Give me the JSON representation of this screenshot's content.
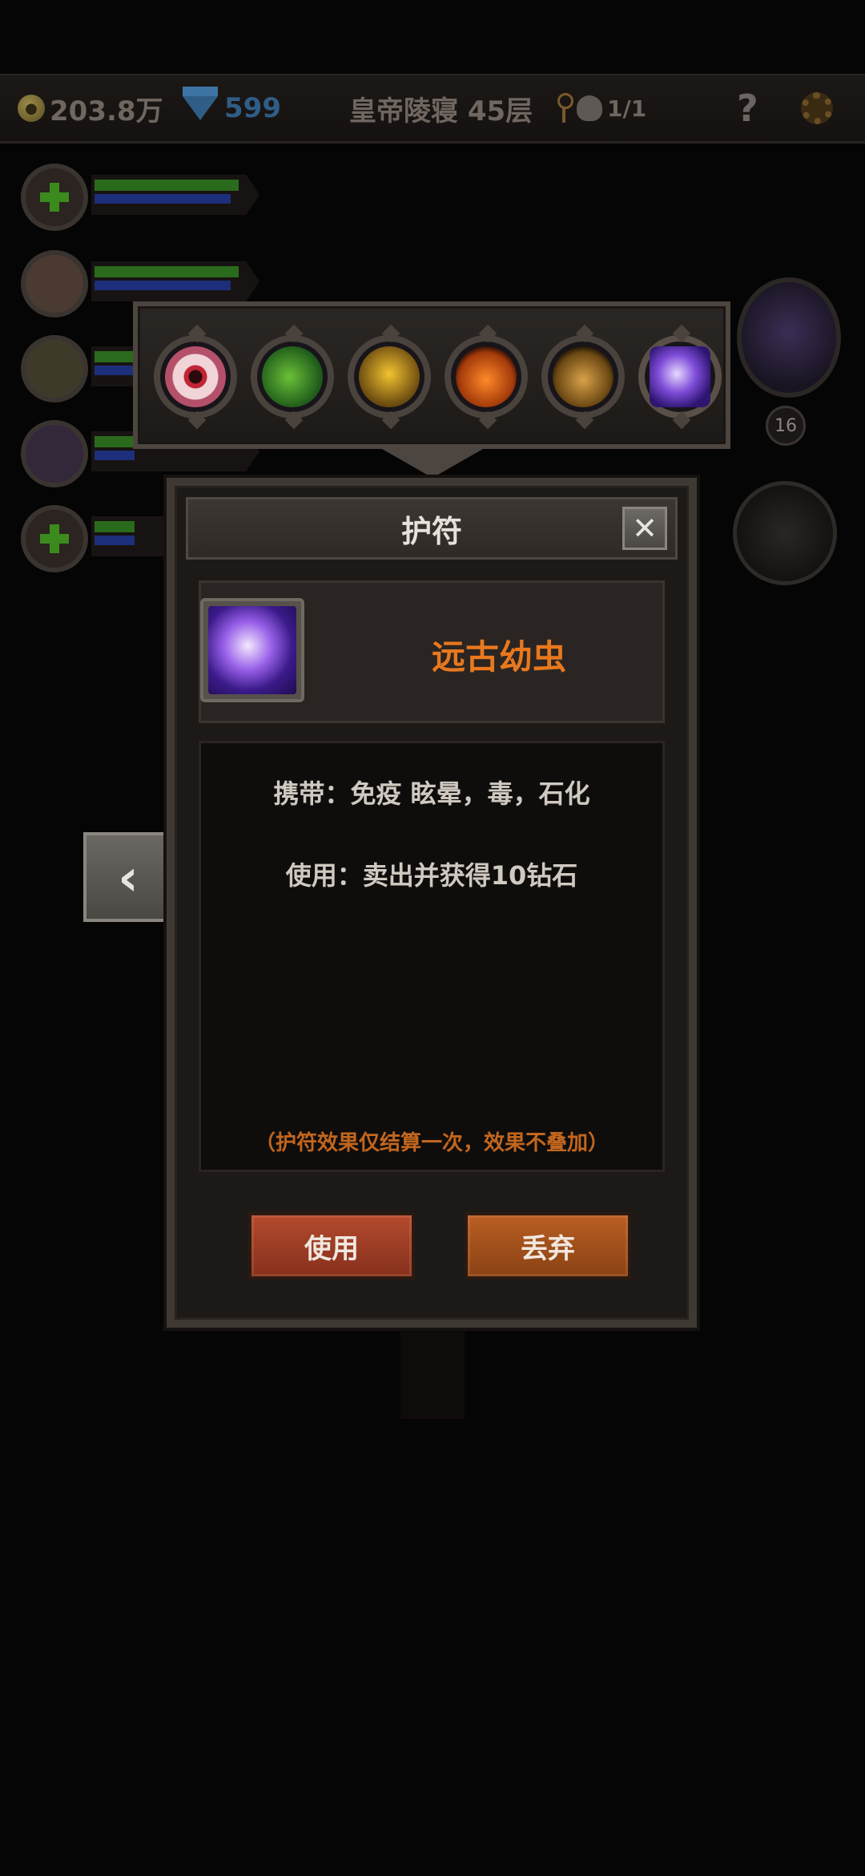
{
  "status_bar": {
    "gold": "203.8万",
    "diamonds": "599",
    "location": "皇帝陵寝 45层",
    "kills": "1/1",
    "help_label": "?"
  },
  "right_panel": {
    "hero_level": "16"
  },
  "amulet_bar": {
    "slots": [
      {
        "icon": "eye-amulet-icon"
      },
      {
        "icon": "leaf-amulet-icon"
      },
      {
        "icon": "feather-amulet-icon"
      },
      {
        "icon": "pumpkin-amulet-icon"
      },
      {
        "icon": "bell-amulet-icon"
      },
      {
        "icon": "spirit-amulet-icon",
        "selected": true
      }
    ]
  },
  "dialog": {
    "title": "护符",
    "close_label": "✕",
    "item_name": "远古幼虫",
    "carry_text": "携带：免疫 眩晕，毒，石化",
    "use_text": "使用：卖出并获得10钻石",
    "note": "（护符效果仅结算一次，效果不叠加）",
    "use_button": "使用",
    "discard_button": "丢弃"
  },
  "back_label": "‹",
  "colors": {
    "accent_orange": "#e8781e",
    "note_orange": "#c2661e",
    "use_red": "#b34a2e",
    "discard_orange": "#b85e22",
    "diamond_blue": "#2f5d86"
  }
}
